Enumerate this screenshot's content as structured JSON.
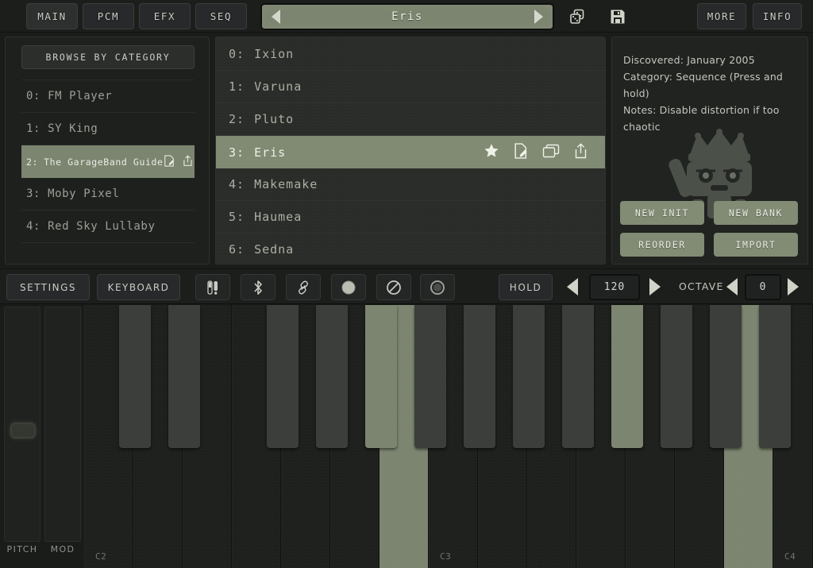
{
  "header": {
    "tabs": [
      {
        "label": "MAIN",
        "active": true
      },
      {
        "label": "PCM",
        "active": false
      },
      {
        "label": "EFX",
        "active": false
      },
      {
        "label": "SEQ",
        "active": false
      }
    ],
    "preset_name": "Eris",
    "prev_icon": "triangle-left-icon",
    "next_icon": "triangle-right-icon",
    "dice_icon": "dice-icon",
    "save_icon": "floppy-disk-icon",
    "more_label": "MORE",
    "info_label": "INFO"
  },
  "sidebar": {
    "browse_label": "BROWSE BY CATEGORY",
    "items": [
      {
        "index": "",
        "label": "",
        "clipped": true,
        "selected": false
      },
      {
        "index": "0:",
        "label": "FM Player",
        "selected": false
      },
      {
        "index": "1:",
        "label": "SY King",
        "selected": false
      },
      {
        "index": "2:",
        "label": "The GarageBand Guide",
        "selected": true
      },
      {
        "index": "3:",
        "label": "Moby Pixel",
        "selected": false
      },
      {
        "index": "4:",
        "label": "Red Sky Lullaby",
        "selected": false
      }
    ]
  },
  "presets": {
    "rows": [
      {
        "index": "0:",
        "name": "Ixion",
        "selected": false
      },
      {
        "index": "1:",
        "name": "Varuna",
        "selected": false
      },
      {
        "index": "2:",
        "name": "Pluto",
        "selected": false
      },
      {
        "index": "3:",
        "name": "Eris",
        "selected": true
      },
      {
        "index": "4:",
        "name": "Makemake",
        "selected": false
      },
      {
        "index": "5:",
        "name": "Haumea",
        "selected": false
      },
      {
        "index": "6:",
        "name": "Sedna",
        "selected": false
      }
    ],
    "row_actions": [
      "star-icon",
      "rename-icon",
      "duplicate-icon",
      "share-icon"
    ]
  },
  "info": {
    "discovered": "Discovered: January 2005",
    "category": "Category: Sequence (Press and hold)",
    "notes": "Notes: Disable distortion if too chaotic",
    "mascot_icon": "robot-king-mascot-icon",
    "buttons": [
      {
        "label": "NEW INIT"
      },
      {
        "label": "NEW BANK"
      },
      {
        "label": "REORDER"
      },
      {
        "label": "IMPORT"
      }
    ]
  },
  "toolbar": {
    "settings_label": "SETTINGS",
    "keyboard_label": "KEYBOARD",
    "icons": [
      "sliders-icon",
      "bluetooth-icon",
      "link-icon",
      "sphere-icon",
      "no-entry-icon",
      "record-icon"
    ],
    "hold_label": "HOLD",
    "tempo_value": "120",
    "tempo_prev_icon": "triangle-left-icon",
    "tempo_next_icon": "triangle-right-icon",
    "octave_label": "OCTAVE",
    "octave_value": "0",
    "octave_prev_icon": "triangle-left-icon",
    "octave_next_icon": "triangle-right-icon"
  },
  "keyboard": {
    "pitch_label": "PITCH",
    "mod_label": "MOD",
    "octave_labels": [
      "C2",
      "C3",
      "C4"
    ],
    "white_keys_active": [
      6,
      13,
      20
    ],
    "black_keys_active": [
      4,
      9,
      14
    ],
    "accent_color": "#7c856f",
    "white_key_color": "#1e201e",
    "black_key_color": "#3b3e3a"
  },
  "colors": {
    "background": "#1a1c1a",
    "panel": "#222422",
    "accent": "#7c856f",
    "text": "#c3c7bc"
  }
}
